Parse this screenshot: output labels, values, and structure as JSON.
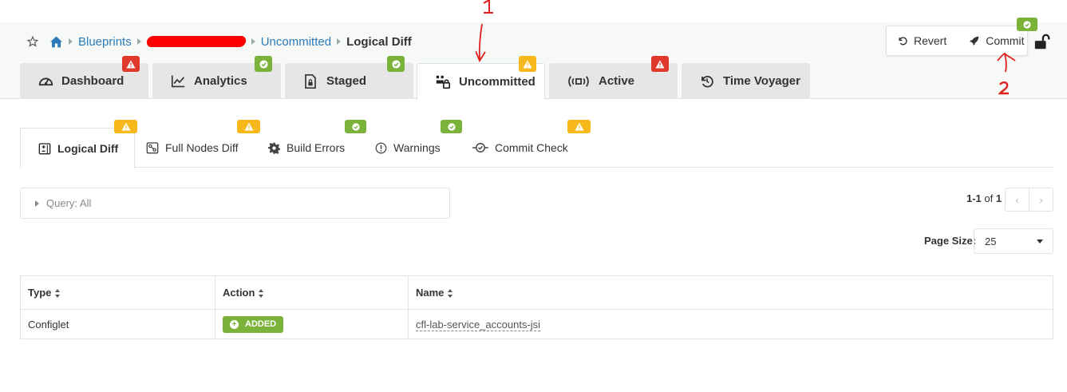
{
  "colors": {
    "link": "#2b7bb9",
    "danger": "#e0392b",
    "warning": "#f7b81b",
    "success": "#7bb33a",
    "annotation": "#e0201e"
  },
  "breadcrumb": {
    "home_icon": "home-icon",
    "star_icon": "star-icon",
    "items": [
      "Blueprints",
      "Uncommitted"
    ],
    "current": "Logical Diff"
  },
  "tabs": [
    {
      "label": "Dashboard",
      "icon": "dashboard-icon",
      "status": "danger"
    },
    {
      "label": "Analytics",
      "icon": "chart-line-icon",
      "status": "success"
    },
    {
      "label": "Staged",
      "icon": "file-lock-icon",
      "status": "success"
    },
    {
      "label": "Uncommitted",
      "icon": "uncommitted-icon",
      "status": "warning",
      "active": true
    },
    {
      "label": "Active",
      "icon": "broadcast-icon",
      "status": "danger"
    },
    {
      "label": "Time Voyager",
      "icon": "history-icon"
    }
  ],
  "toolbar": {
    "revert_label": "Revert",
    "commit_label": "Commit",
    "commit_status": "success"
  },
  "subtabs": [
    {
      "label": "Logical Diff",
      "icon": "diff-icon",
      "status": "warning",
      "active": true
    },
    {
      "label": "Full Nodes Diff",
      "icon": "nodes-diff-icon",
      "status": "warning"
    },
    {
      "label": "Build Errors",
      "icon": "gear-icon",
      "status": "success"
    },
    {
      "label": "Warnings",
      "icon": "exclamation-circle-icon",
      "status": "success"
    },
    {
      "label": "Commit Check",
      "icon": "commit-check-icon",
      "status": "warning"
    }
  ],
  "query": {
    "label": "Query: All"
  },
  "pagination": {
    "range": "1-1",
    "of_label": "of",
    "total": "1",
    "page_size_label": "Page Size:",
    "page_size": "25"
  },
  "table": {
    "headers": [
      "Type",
      "Action",
      "Name"
    ],
    "rows": [
      {
        "type": "Configlet",
        "action": "ADDED",
        "name": "cfl-lab-service_accounts-jsi"
      }
    ]
  },
  "annotations": {
    "first": "1",
    "second": "2"
  }
}
